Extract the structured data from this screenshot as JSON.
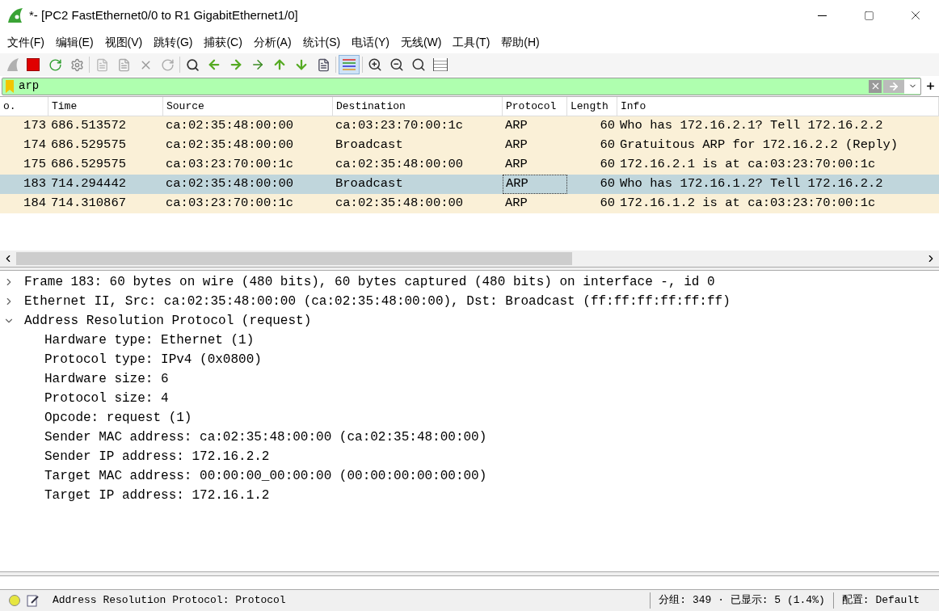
{
  "window": {
    "title": "*- [PC2 FastEthernet0/0 to R1 GigabitEthernet1/0]"
  },
  "menu": [
    "文件(F)",
    "编辑(E)",
    "视图(V)",
    "跳转(G)",
    "捕获(C)",
    "分析(A)",
    "统计(S)",
    "电话(Y)",
    "无线(W)",
    "工具(T)",
    "帮助(H)"
  ],
  "toolbar": {
    "colorize_pressed": true
  },
  "filter": {
    "value": "arp"
  },
  "packet_list": {
    "columns": [
      "o.",
      "Time",
      "Source",
      "Destination",
      "Protocol",
      "Length",
      "Info"
    ],
    "rows": [
      {
        "cells": [
          "173",
          "686.513572",
          "ca:02:35:48:00:00",
          "ca:03:23:70:00:1c",
          "ARP",
          "60",
          "Who has 172.16.2.1? Tell 172.16.2.2"
        ],
        "selected": false
      },
      {
        "cells": [
          "174",
          "686.529575",
          "ca:02:35:48:00:00",
          "Broadcast",
          "ARP",
          "60",
          "Gratuitous ARP for 172.16.2.2 (Reply)"
        ],
        "selected": false
      },
      {
        "cells": [
          "175",
          "686.529575",
          "ca:03:23:70:00:1c",
          "ca:02:35:48:00:00",
          "ARP",
          "60",
          "172.16.2.1 is at ca:03:23:70:00:1c"
        ],
        "selected": false
      },
      {
        "cells": [
          "183",
          "714.294442",
          "ca:02:35:48:00:00",
          "Broadcast",
          "ARP",
          "60",
          "Who has 172.16.1.2? Tell 172.16.2.2"
        ],
        "selected": true
      },
      {
        "cells": [
          "184",
          "714.310867",
          "ca:03:23:70:00:1c",
          "ca:02:35:48:00:00",
          "ARP",
          "60",
          "172.16.1.2 is at ca:03:23:70:00:1c"
        ],
        "selected": false
      }
    ]
  },
  "details": [
    {
      "text": "Frame 183: 60 bytes on wire (480 bits), 60 bytes captured (480 bits) on interface -, id 0",
      "expanded": false
    },
    {
      "text": "Ethernet II, Src: ca:02:35:48:00:00 (ca:02:35:48:00:00), Dst: Broadcast (ff:ff:ff:ff:ff:ff)",
      "expanded": false
    },
    {
      "text": "Address Resolution Protocol (request)",
      "expanded": true,
      "children": [
        {
          "text": "Hardware type: Ethernet (1)"
        },
        {
          "text": "Protocol type: IPv4 (0x0800)"
        },
        {
          "text": "Hardware size: 6"
        },
        {
          "text": "Protocol size: 4"
        },
        {
          "text": "Opcode: request (1)"
        },
        {
          "text": "Sender MAC address: ca:02:35:48:00:00 (ca:02:35:48:00:00)"
        },
        {
          "text": "Sender IP address: 172.16.2.2"
        },
        {
          "text": "Target MAC address: 00:00:00_00:00:00 (00:00:00:00:00:00)"
        },
        {
          "text": "Target IP address: 172.16.1.2"
        }
      ]
    }
  ],
  "status_bar": {
    "field_info": "Address Resolution Protocol: Protocol",
    "packets": "分组: 349 · 已显示: 5 (1.4%)",
    "profile": "配置: Default"
  }
}
